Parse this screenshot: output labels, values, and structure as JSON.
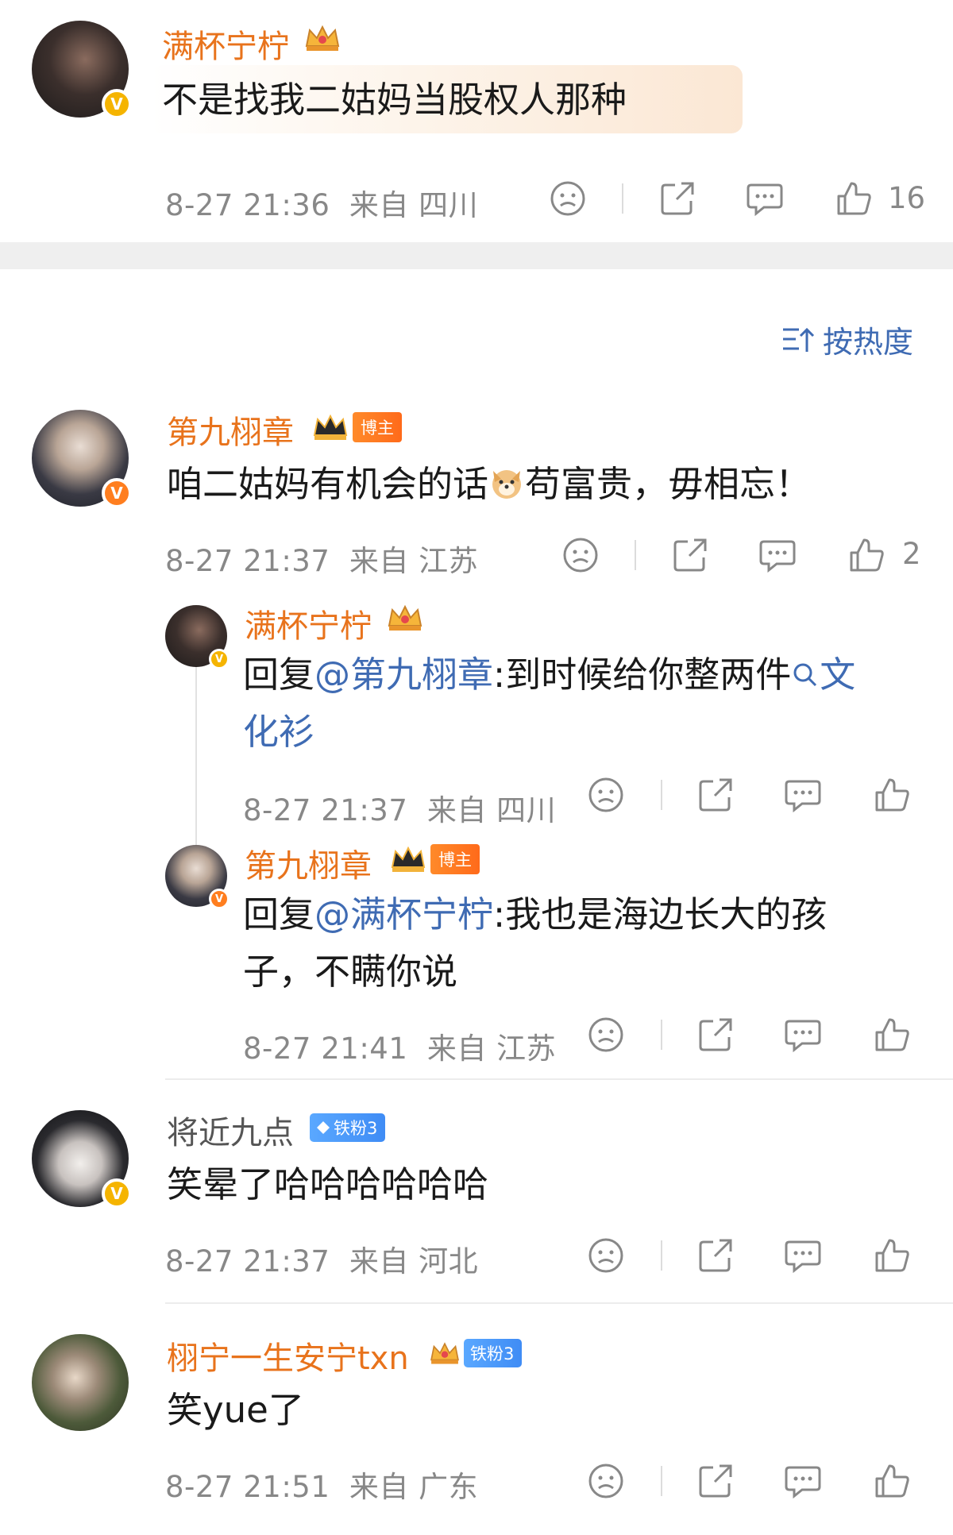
{
  "top_comment": {
    "username": "满杯宁柠",
    "text": "不是找我二姑妈当股权人那种",
    "time": "8-27 21:36",
    "location": "来自 四川",
    "likes": "16"
  },
  "sort_label": "按热度",
  "comments": [
    {
      "username": "第九栩章",
      "tag": "博主",
      "text_a": "咱二姑妈有机会的话",
      "text_b": "苟富贵，毋相忘！",
      "time": "8-27 21:37",
      "location": "来自 江苏",
      "likes": "2",
      "replies": [
        {
          "username": "满杯宁柠",
          "reply_prefix": "回复",
          "mention": "@第九栩章",
          "text_a": ":到时候给你整两件",
          "topic_a": "文",
          "topic_b": "化衫",
          "time": "8-27 21:37",
          "location": "来自 四川"
        },
        {
          "username": "第九栩章",
          "tag": "博主",
          "reply_prefix": "回复",
          "mention": "@满杯宁柠",
          "text_a": ":我也是海边长大的孩",
          "text_b": "子，不瞒你说",
          "time": "8-27 21:41",
          "location": "来自 江苏"
        }
      ]
    },
    {
      "username": "将近九点",
      "tag": "铁粉3",
      "text": "笑晕了哈哈哈哈哈哈",
      "time": "8-27 21:37",
      "location": "来自 河北"
    },
    {
      "username": "栩宁一生安宁txn",
      "tag": "铁粉3",
      "text": "笑yue了",
      "time": "8-27 21:51",
      "location": "来自 广东"
    }
  ],
  "icons": [
    "sad-face-icon",
    "share-icon",
    "comment-icon",
    "thumbs-up-icon",
    "crown-icon",
    "verified-icon",
    "search-icon",
    "sort-icon"
  ],
  "colors": {
    "username_orange": "#e8731c",
    "link_blue": "#3f6bb3",
    "meta_gray": "#888888",
    "verified_gold": "#f5b400",
    "tag_orange": "#ff7e1f",
    "tag_blue": "#4a97fa"
  }
}
